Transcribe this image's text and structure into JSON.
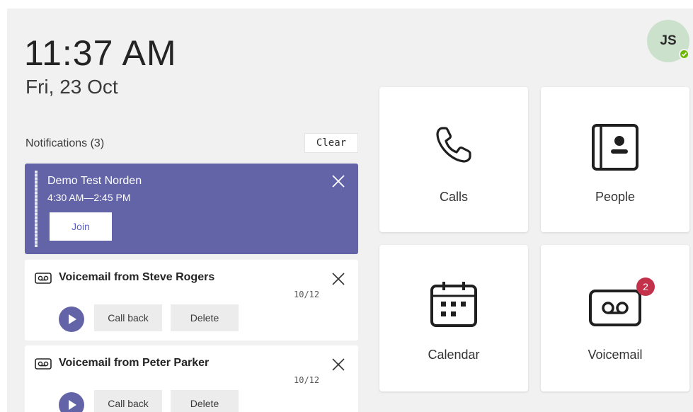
{
  "header": {
    "time": "11:37 AM",
    "date": "Fri, 23 Oct",
    "avatar_initials": "JS",
    "presence_color": "#6bb700"
  },
  "notifications": {
    "header": "Notifications (3)",
    "clear_label": "Clear",
    "meeting": {
      "title": "Demo Test Norden",
      "time": "4:30 AM—2:45 PM",
      "join_label": "Join",
      "color": "#6264a7"
    },
    "voicemails": [
      {
        "title": "Voicemail from Steve Rogers",
        "date": "10/12",
        "callback_label": "Call back",
        "delete_label": "Delete"
      },
      {
        "title": "Voicemail from Peter Parker",
        "date": "10/12",
        "callback_label": "Call back",
        "delete_label": "Delete"
      }
    ]
  },
  "tiles": [
    {
      "label": "Calls",
      "icon": "phone-icon"
    },
    {
      "label": "People",
      "icon": "contact-card-icon"
    },
    {
      "label": "Calendar",
      "icon": "calendar-icon"
    },
    {
      "label": "Voicemail",
      "icon": "voicemail-icon",
      "badge": "2"
    }
  ],
  "colors": {
    "accent": "#6264a7",
    "badge": "#c4314b",
    "background": "#f1f1f1"
  }
}
